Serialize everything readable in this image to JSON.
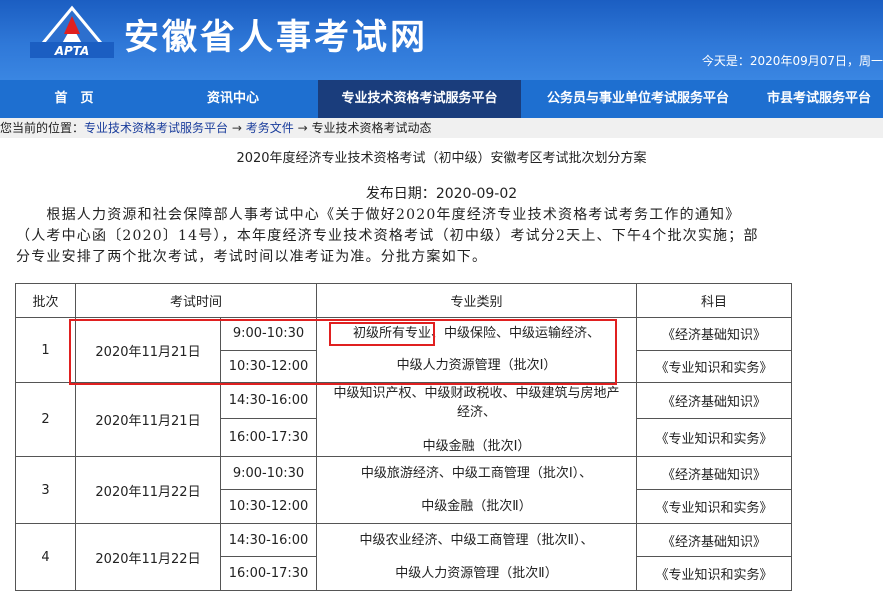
{
  "header": {
    "logo_text": "APTA",
    "site_title": "安徽省人事考试网",
    "date_text": "今天是：2020年09月07日，周一"
  },
  "nav": {
    "items": [
      "首　页",
      "资讯中心",
      "专业技术资格考试服务平台",
      "公务员与事业单位考试服务平台",
      "市县考试服务平台"
    ],
    "active_index": 2
  },
  "breadcrumb": {
    "prefix": "您当前的位置：",
    "links": [
      "专业技术资格考试服务平台",
      "考务文件"
    ],
    "current": "专业技术资格考试动态",
    "separator": "→"
  },
  "article": {
    "title": "2020年度经济专业技术资格考试（初中级）安徽考区考试批次划分方案",
    "publish_label": "发布日期：",
    "publish_date": "2020-09-02",
    "paragraph_lines": [
      "　　根据人力资源和社会保障部人事考试中心《关于做好2020年度经济专业技术资格考试考务工作的通知》",
      "（人考中心函〔2020〕14号），本年度经济专业技术资格考试（初中级）考试分2天上、下午4个批次实施；部",
      "分专业安排了两个批次考试，考试时间以准考证为准。分批方案如下。"
    ]
  },
  "table": {
    "headers": {
      "batch": "批次",
      "time": "考试时间",
      "major": "专业类别",
      "subject": "科目"
    },
    "rows": [
      {
        "batch": "1",
        "date": "2020年11月21日",
        "times": [
          "9:00-10:30",
          "10:30-12:00"
        ],
        "major_a": "初级所有专业、",
        "major_b": "中级保险、中级运输经济、",
        "major_c": "中级人力资源管理（批次Ⅰ）",
        "subjects": [
          "《经济基础知识》",
          "《专业知识和实务》"
        ]
      },
      {
        "batch": "2",
        "date": "2020年11月21日",
        "times": [
          "14:30-16:00",
          "16:00-17:30"
        ],
        "major_l1": "中级知识产权、中级财政税收、中级建筑与房地产",
        "major_l2": "经济、",
        "major_l3": "中级金融（批次Ⅰ）",
        "subjects": [
          "《经济基础知识》",
          "《专业知识和实务》"
        ]
      },
      {
        "batch": "3",
        "date": "2020年11月22日",
        "times": [
          "9:00-10:30",
          "10:30-12:00"
        ],
        "major_l1": "中级旅游经济、中级工商管理（批次Ⅰ）、",
        "major_l2": "中级金融（批次Ⅱ）",
        "subjects": [
          "《经济基础知识》",
          "《专业知识和实务》"
        ]
      },
      {
        "batch": "4",
        "date": "2020年11月22日",
        "times": [
          "14:30-16:00",
          "16:00-17:30"
        ],
        "major_l1": "中级农业经济、中级工商管理（批次Ⅱ）、",
        "major_l2": "中级人力资源管理（批次Ⅱ）",
        "subjects": [
          "《经济基础知识》",
          "《专业知识和实务》"
        ]
      }
    ]
  },
  "colors": {
    "banner": "#2f78d8",
    "nav": "#1e6fd0",
    "nav_active": "#1a3d7c",
    "highlight": "#e02020"
  }
}
